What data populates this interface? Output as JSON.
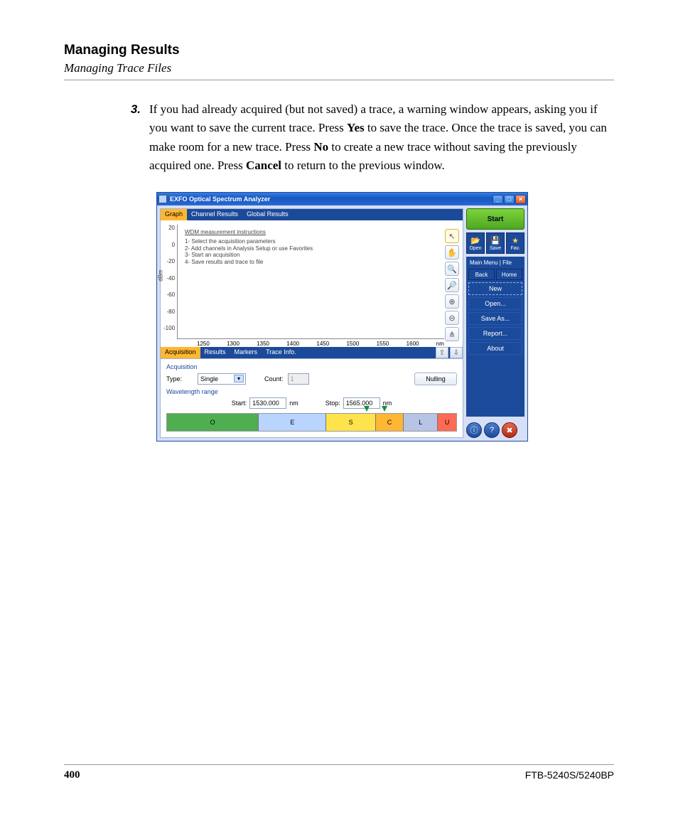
{
  "doc": {
    "section_title": "Managing Results",
    "section_sub": "Managing Trace Files",
    "step_num": "3.",
    "step_text_1": "If you had already acquired (but not saved) a trace, a warning window appears, asking you if you want to save the current trace. Press ",
    "step_yes": "Yes",
    "step_text_2": " to save the trace. Once the trace is saved, you can make room for a new trace. Press ",
    "step_no": "No",
    "step_text_3": " to create a new trace without saving the previously acquired one. Press ",
    "step_cancel": "Cancel",
    "step_text_4": " to return to the previous window.",
    "page_num": "400",
    "model": "FTB-5240S/5240BP"
  },
  "app": {
    "title": "EXFO Optical Spectrum Analyzer",
    "top_tabs": [
      "Graph",
      "Channel Results",
      "Global Results"
    ],
    "y_ticks": [
      "20",
      "0",
      "-20",
      "-40",
      "-60",
      "-80",
      "-100"
    ],
    "y_label": "dBm",
    "x_ticks": [
      "1250",
      "1300",
      "1350",
      "1400",
      "1450",
      "1500",
      "1550",
      "1600",
      "nm"
    ],
    "instructions_title": "WDM measurement instructions",
    "instructions": [
      "1- Select the acquisition parameters",
      "2- Add channels in Analysis Setup or use Favorites",
      "3- Start an acquisition",
      "4- Save results and trace to file"
    ],
    "bottom_tabs": [
      "Acquisition",
      "Results",
      "Markers",
      "Trace Info."
    ],
    "acq_group": "Acquisition",
    "type_label": "Type:",
    "type_value": "Single",
    "count_label": "Count:",
    "count_value": "1",
    "nulling": "Nulling",
    "wav_group": "Wavelength range",
    "start_label": "Start:",
    "start_value": "1530.000",
    "stop_label": "Stop:",
    "stop_value": "1565.000",
    "nm": "nm",
    "bands": [
      {
        "label": "O",
        "color": "#4fae4f",
        "flex": 3
      },
      {
        "label": "E",
        "color": "#b8d4ff",
        "flex": 2.2
      },
      {
        "label": "S",
        "color": "#ffe34d",
        "flex": 1.6
      },
      {
        "label": "C",
        "color": "#ffb733",
        "flex": 0.9
      },
      {
        "label": "L",
        "color": "#b8c4e6",
        "flex": 1.1
      },
      {
        "label": "U",
        "color": "#ff6a55",
        "flex": 0.6
      }
    ],
    "sidebar": {
      "start": "Start",
      "open": "Open",
      "save": "Save",
      "fav": "Fav.",
      "crumb": "Main Menu | File",
      "back": "Back",
      "home": "Home",
      "menu": [
        "New",
        "Open...",
        "Save As...",
        "Report...",
        "About"
      ]
    }
  }
}
